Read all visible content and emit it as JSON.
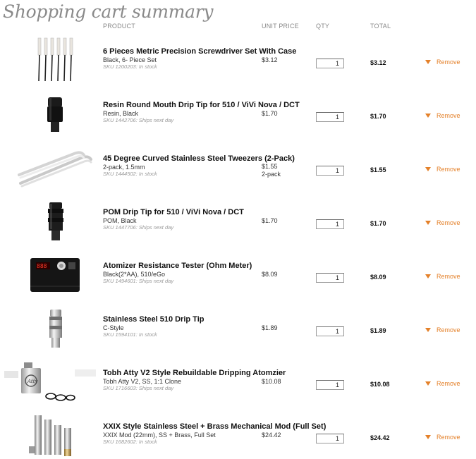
{
  "page": {
    "title": "Shopping cart summary"
  },
  "columns": {
    "product": "PRODUCT",
    "unit_price": "UNIT PRICE",
    "qty": "QTY",
    "total": "TOTAL"
  },
  "remove_label": "Remove",
  "items": [
    {
      "name": "6 Pieces Metric Precision Screwdriver Set With Case",
      "variant": "Black, 6- Piece Set",
      "sku": "SKU 1200203: In stock",
      "unit_price": "$3.12",
      "price_note": "",
      "qty": "1",
      "total": "$3.12",
      "image": "screwdriver-set-image"
    },
    {
      "name": "Resin Round Mouth Drip Tip for 510 / ViVi Nova / DCT",
      "variant": "Resin, Black",
      "sku": "SKU 1442706: Ships next day",
      "unit_price": "$1.70",
      "price_note": "",
      "qty": "1",
      "total": "$1.70",
      "image": "resin-drip-tip-image"
    },
    {
      "name": "45 Degree Curved Stainless Steel Tweezers (2-Pack)",
      "variant": "2-pack, 1.5mm",
      "sku": "SKU 1444502: In stock",
      "unit_price": "$1.55",
      "price_note": "2-pack",
      "qty": "1",
      "total": "$1.55",
      "image": "tweezers-image"
    },
    {
      "name": "POM Drip Tip for 510 / ViVi Nova / DCT",
      "variant": "POM, Black",
      "sku": "SKU 1447706: Ships next day",
      "unit_price": "$1.70",
      "price_note": "",
      "qty": "1",
      "total": "$1.70",
      "image": "pom-drip-tip-image"
    },
    {
      "name": "Atomizer Resistance Tester (Ohm Meter)",
      "variant": "Black(2*AA), 510/eGo",
      "sku": "SKU 1494601: Ships next day",
      "unit_price": "$8.09",
      "price_note": "",
      "qty": "1",
      "total": "$8.09",
      "image": "ohm-meter-image"
    },
    {
      "name": "Stainless Steel 510 Drip Tip",
      "variant": "C-Style",
      "sku": "SKU 1594101: In stock",
      "unit_price": "$1.89",
      "price_note": "",
      "qty": "1",
      "total": "$1.89",
      "image": "steel-drip-tip-image"
    },
    {
      "name": "Tobh Atty V2 Style Rebuildable Dripping Atomzier",
      "variant": "Tobh Atty V2, SS, 1:1 Clone",
      "sku": "SKU 1716603: Ships next day",
      "unit_price": "$10.08",
      "price_note": "",
      "qty": "1",
      "total": "$10.08",
      "image": "atomizer-image"
    },
    {
      "name": "XXIX Style Stainless Steel + Brass Mechanical Mod (Full Set)",
      "variant": "XXIX Mod (22mm), SS + Brass, Full Set",
      "sku": "SKU 1682602: In stock",
      "unit_price": "$24.42",
      "price_note": "",
      "qty": "1",
      "total": "$24.42",
      "image": "mechanical-mod-image"
    }
  ]
}
